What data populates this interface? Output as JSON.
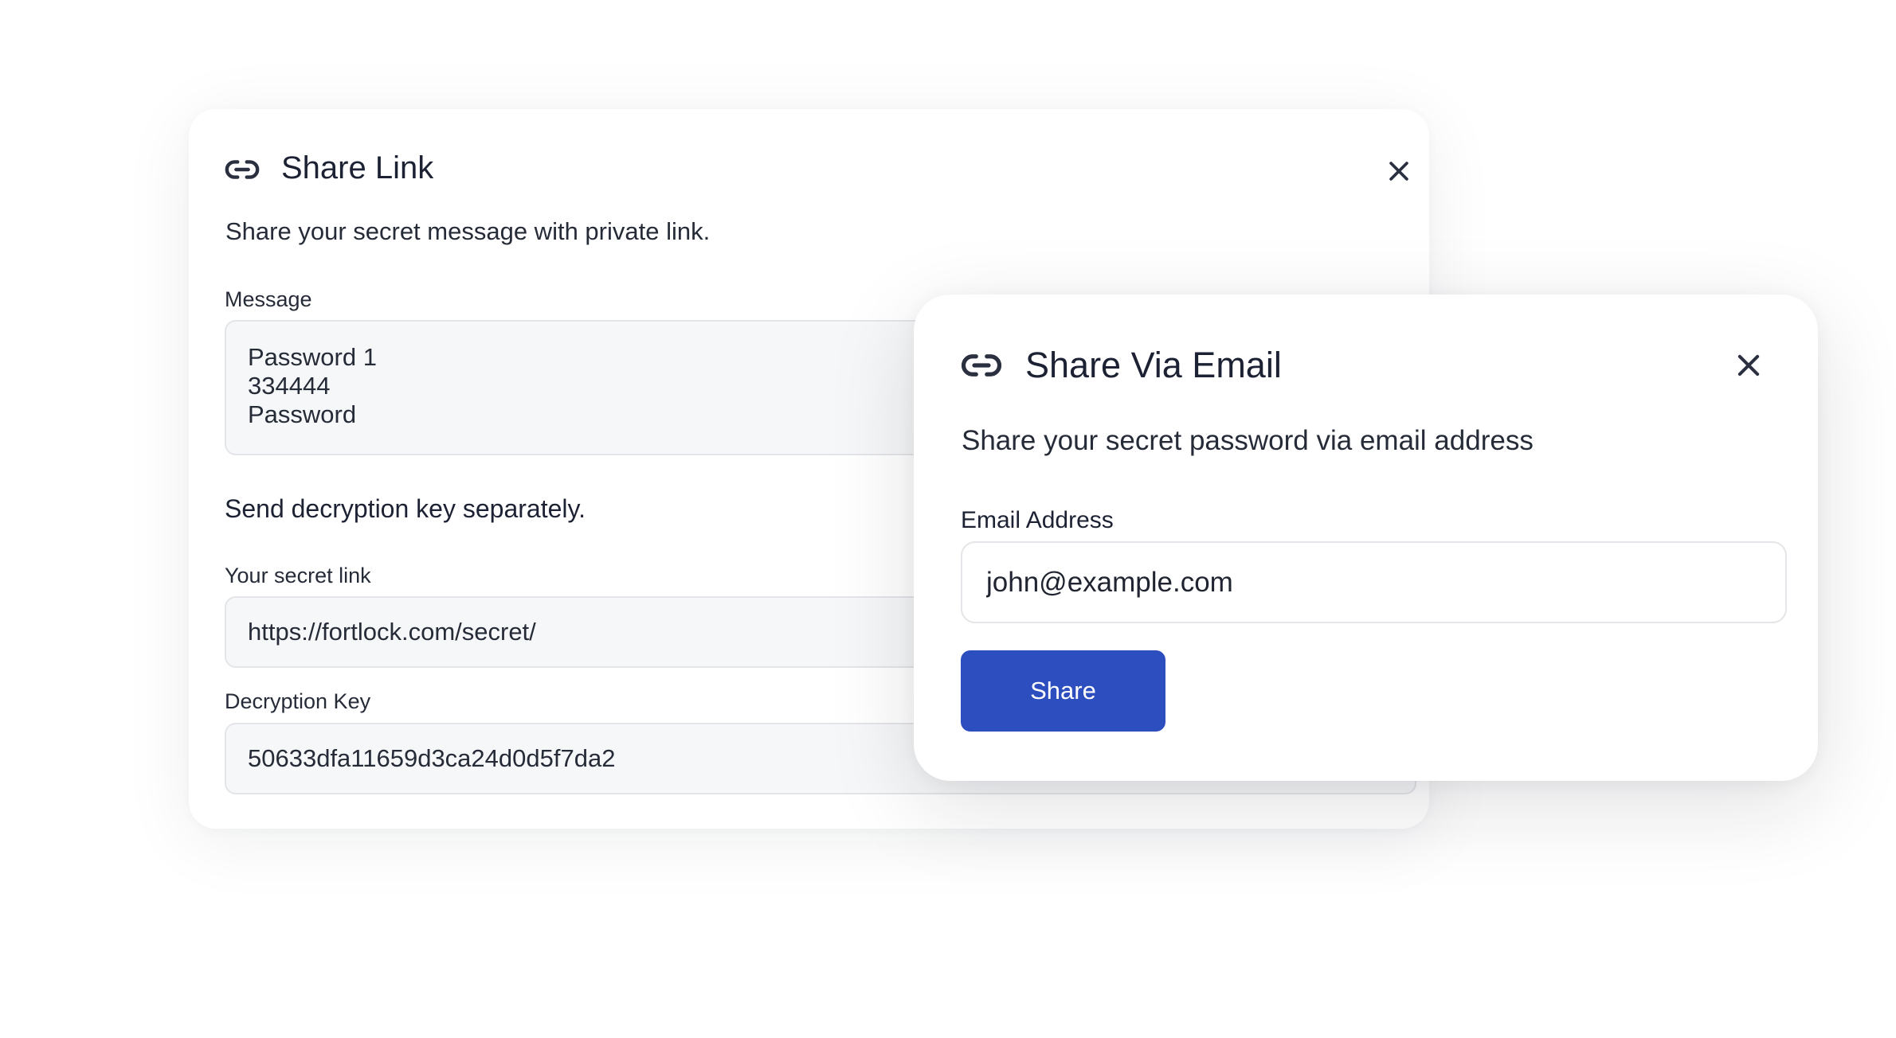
{
  "share_link_dialog": {
    "title": "Share Link",
    "subtitle": "Share your secret message with private link.",
    "message_label": "Message",
    "message_lines": [
      "Password 1",
      "334444",
      "Password"
    ],
    "section_heading": "Send decryption key separately.",
    "secret_link_label": "Your secret link",
    "secret_link_value": "https://fortlock.com/secret/",
    "decryption_key_label": "Decryption Key",
    "decryption_key_value": "50633dfa11659d3ca24d0d5f7da2",
    "icons": {
      "header": "link-icon",
      "close": "close-icon"
    }
  },
  "share_email_dialog": {
    "title": "Share Via Email",
    "subtitle": "Share your secret password via email address",
    "email_label": "Email Address",
    "email_value": "john@example.com",
    "share_label": "Share",
    "icons": {
      "header": "link-icon",
      "close": "close-icon"
    }
  },
  "colors": {
    "primary_button": "#2d4ebf",
    "text": "#1c2233",
    "readonly_field_bg": "#f6f7f8",
    "border": "#e3e5e8"
  }
}
